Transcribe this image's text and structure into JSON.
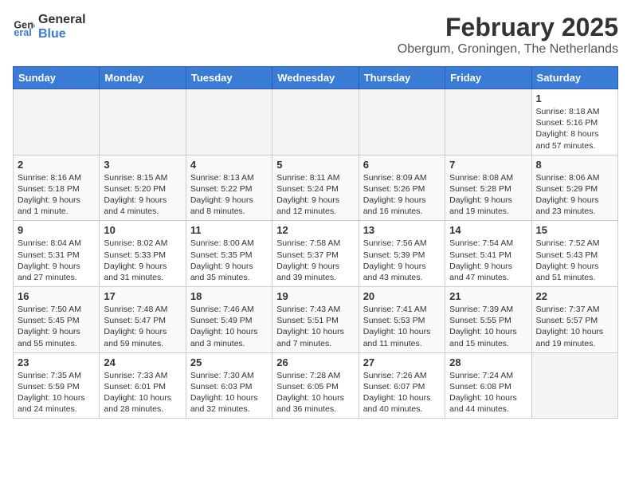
{
  "logo": {
    "line1": "General",
    "line2": "Blue"
  },
  "title": "February 2025",
  "location": "Obergum, Groningen, The Netherlands",
  "days_of_week": [
    "Sunday",
    "Monday",
    "Tuesday",
    "Wednesday",
    "Thursday",
    "Friday",
    "Saturday"
  ],
  "weeks": [
    [
      {
        "day": "",
        "info": ""
      },
      {
        "day": "",
        "info": ""
      },
      {
        "day": "",
        "info": ""
      },
      {
        "day": "",
        "info": ""
      },
      {
        "day": "",
        "info": ""
      },
      {
        "day": "",
        "info": ""
      },
      {
        "day": "1",
        "info": "Sunrise: 8:18 AM\nSunset: 5:16 PM\nDaylight: 8 hours and 57 minutes."
      }
    ],
    [
      {
        "day": "2",
        "info": "Sunrise: 8:16 AM\nSunset: 5:18 PM\nDaylight: 9 hours and 1 minute."
      },
      {
        "day": "3",
        "info": "Sunrise: 8:15 AM\nSunset: 5:20 PM\nDaylight: 9 hours and 4 minutes."
      },
      {
        "day": "4",
        "info": "Sunrise: 8:13 AM\nSunset: 5:22 PM\nDaylight: 9 hours and 8 minutes."
      },
      {
        "day": "5",
        "info": "Sunrise: 8:11 AM\nSunset: 5:24 PM\nDaylight: 9 hours and 12 minutes."
      },
      {
        "day": "6",
        "info": "Sunrise: 8:09 AM\nSunset: 5:26 PM\nDaylight: 9 hours and 16 minutes."
      },
      {
        "day": "7",
        "info": "Sunrise: 8:08 AM\nSunset: 5:28 PM\nDaylight: 9 hours and 19 minutes."
      },
      {
        "day": "8",
        "info": "Sunrise: 8:06 AM\nSunset: 5:29 PM\nDaylight: 9 hours and 23 minutes."
      }
    ],
    [
      {
        "day": "9",
        "info": "Sunrise: 8:04 AM\nSunset: 5:31 PM\nDaylight: 9 hours and 27 minutes."
      },
      {
        "day": "10",
        "info": "Sunrise: 8:02 AM\nSunset: 5:33 PM\nDaylight: 9 hours and 31 minutes."
      },
      {
        "day": "11",
        "info": "Sunrise: 8:00 AM\nSunset: 5:35 PM\nDaylight: 9 hours and 35 minutes."
      },
      {
        "day": "12",
        "info": "Sunrise: 7:58 AM\nSunset: 5:37 PM\nDaylight: 9 hours and 39 minutes."
      },
      {
        "day": "13",
        "info": "Sunrise: 7:56 AM\nSunset: 5:39 PM\nDaylight: 9 hours and 43 minutes."
      },
      {
        "day": "14",
        "info": "Sunrise: 7:54 AM\nSunset: 5:41 PM\nDaylight: 9 hours and 47 minutes."
      },
      {
        "day": "15",
        "info": "Sunrise: 7:52 AM\nSunset: 5:43 PM\nDaylight: 9 hours and 51 minutes."
      }
    ],
    [
      {
        "day": "16",
        "info": "Sunrise: 7:50 AM\nSunset: 5:45 PM\nDaylight: 9 hours and 55 minutes."
      },
      {
        "day": "17",
        "info": "Sunrise: 7:48 AM\nSunset: 5:47 PM\nDaylight: 9 hours and 59 minutes."
      },
      {
        "day": "18",
        "info": "Sunrise: 7:46 AM\nSunset: 5:49 PM\nDaylight: 10 hours and 3 minutes."
      },
      {
        "day": "19",
        "info": "Sunrise: 7:43 AM\nSunset: 5:51 PM\nDaylight: 10 hours and 7 minutes."
      },
      {
        "day": "20",
        "info": "Sunrise: 7:41 AM\nSunset: 5:53 PM\nDaylight: 10 hours and 11 minutes."
      },
      {
        "day": "21",
        "info": "Sunrise: 7:39 AM\nSunset: 5:55 PM\nDaylight: 10 hours and 15 minutes."
      },
      {
        "day": "22",
        "info": "Sunrise: 7:37 AM\nSunset: 5:57 PM\nDaylight: 10 hours and 19 minutes."
      }
    ],
    [
      {
        "day": "23",
        "info": "Sunrise: 7:35 AM\nSunset: 5:59 PM\nDaylight: 10 hours and 24 minutes."
      },
      {
        "day": "24",
        "info": "Sunrise: 7:33 AM\nSunset: 6:01 PM\nDaylight: 10 hours and 28 minutes."
      },
      {
        "day": "25",
        "info": "Sunrise: 7:30 AM\nSunset: 6:03 PM\nDaylight: 10 hours and 32 minutes."
      },
      {
        "day": "26",
        "info": "Sunrise: 7:28 AM\nSunset: 6:05 PM\nDaylight: 10 hours and 36 minutes."
      },
      {
        "day": "27",
        "info": "Sunrise: 7:26 AM\nSunset: 6:07 PM\nDaylight: 10 hours and 40 minutes."
      },
      {
        "day": "28",
        "info": "Sunrise: 7:24 AM\nSunset: 6:08 PM\nDaylight: 10 hours and 44 minutes."
      },
      {
        "day": "",
        "info": ""
      }
    ]
  ]
}
